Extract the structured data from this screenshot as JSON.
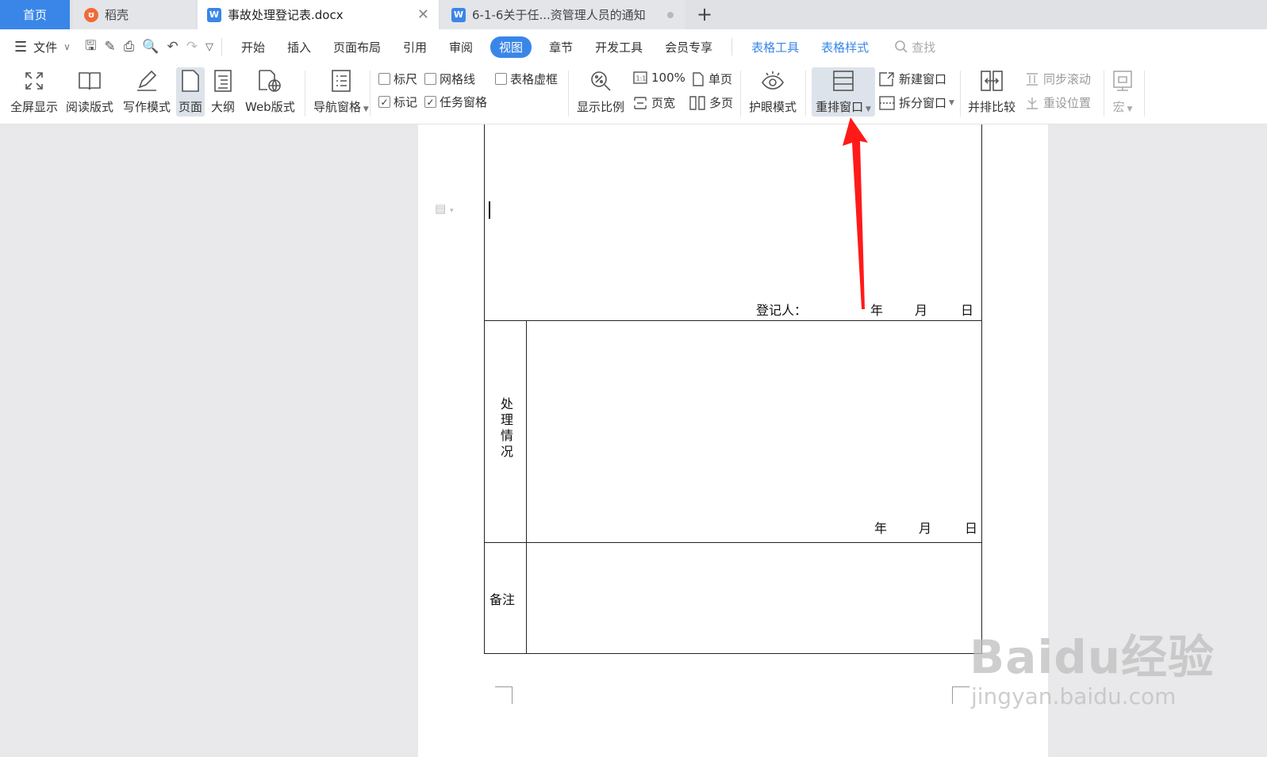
{
  "tabs": {
    "home": "首页",
    "daoke": "稻壳",
    "doc1": "事故处理登记表.docx",
    "doc2": "6-1-6关于任...资管理人员的通知",
    "add": "+"
  },
  "menu": {
    "file": "文件",
    "items": [
      "开始",
      "插入",
      "页面布局",
      "引用",
      "审阅",
      "视图",
      "章节",
      "开发工具",
      "会员专享"
    ],
    "context": [
      "表格工具",
      "表格样式"
    ],
    "search": "查找"
  },
  "ribbon": {
    "fullscreen": "全屏显示",
    "read": "阅读版式",
    "write": "写作模式",
    "page": "页面",
    "outline": "大纲",
    "web": "Web版式",
    "nav": "导航窗格",
    "ruler": "标尺",
    "grid": "网格线",
    "table_frame": "表格虚框",
    "mark": "标记",
    "taskpane": "任务窗格",
    "zoom": "显示比例",
    "percent": "100%",
    "page_width": "页宽",
    "single": "单页",
    "multi": "多页",
    "eye": "护眼模式",
    "rearrange": "重排窗口",
    "new_window": "新建窗口",
    "split": "拆分窗口",
    "side_by_side": "并排比较",
    "sync_scroll": "同步滚动",
    "reset_pos": "重设位置",
    "macro": "宏"
  },
  "document": {
    "registrar": "登记人：",
    "year": "年",
    "month": "月",
    "day": "日",
    "handling": "处理情况",
    "remarks": "备注"
  },
  "watermark": {
    "brand": "Baidu经验",
    "url": "jingyan.baidu.com"
  },
  "colors": {
    "accent": "#3a86e8",
    "arrow": "#ff1a1a"
  }
}
